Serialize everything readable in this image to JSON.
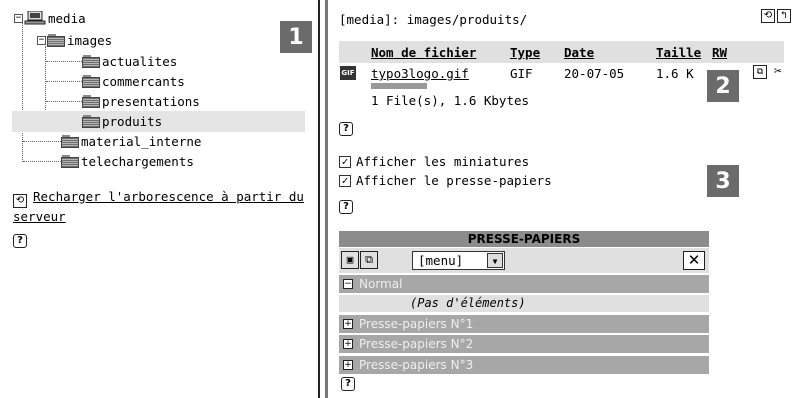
{
  "tree": {
    "root": "media",
    "images": "images",
    "children": [
      "actualites",
      "commercants",
      "presentations",
      "produits"
    ],
    "material": "material_interne",
    "telechargements": "telechargements",
    "reload_link": "Recharger l'arborescence à partir du",
    "reload_link2": "serveur"
  },
  "badges": [
    "1",
    "2",
    "3"
  ],
  "path": "[media]: images/produits/",
  "table": {
    "headers": [
      "Nom de fichier",
      "Type",
      "Date",
      "Taille",
      "RW"
    ],
    "row": {
      "icon": "GIF",
      "name": "typo3logo.gif",
      "type": "GIF",
      "date": "20-07-05",
      "size": "1.6 K"
    },
    "summary": "1 File(s), 1.6 Kbytes"
  },
  "options": {
    "miniatures": "Afficher les miniatures",
    "presse": "Afficher le presse-papiers"
  },
  "clipboard": {
    "title": "PRESSE-PAPIERS",
    "menu": "[menu]",
    "normal": "Normal",
    "empty": "(Pas d'éléments)",
    "pads": [
      "Presse-papiers N°1",
      "Presse-papiers N°2",
      "Presse-papiers N°3"
    ]
  },
  "help_glyph": "?",
  "colors": {
    "badge": "#6b6b6b",
    "selected_row": "#e4e4e4",
    "clip_header": "#8c8c8c",
    "clip_row": "#a7a7a7"
  }
}
